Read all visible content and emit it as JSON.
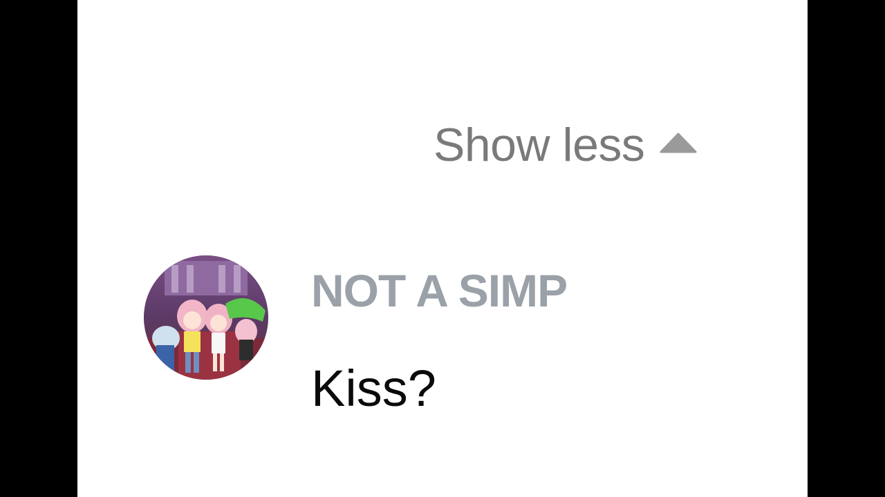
{
  "thread": {
    "show_less_label": "Show less",
    "toggle_icon": "triangle-up-icon"
  },
  "comment": {
    "author": "NOT A SIMP",
    "text": "Kiss?",
    "avatar_icon": "user-avatar"
  },
  "colors": {
    "panel_background": "#ffffff",
    "letterbox": "#000000",
    "show_less_text": "#7a7a7a",
    "author_text": "#9aa1a8",
    "comment_text": "#0a0a0a"
  }
}
